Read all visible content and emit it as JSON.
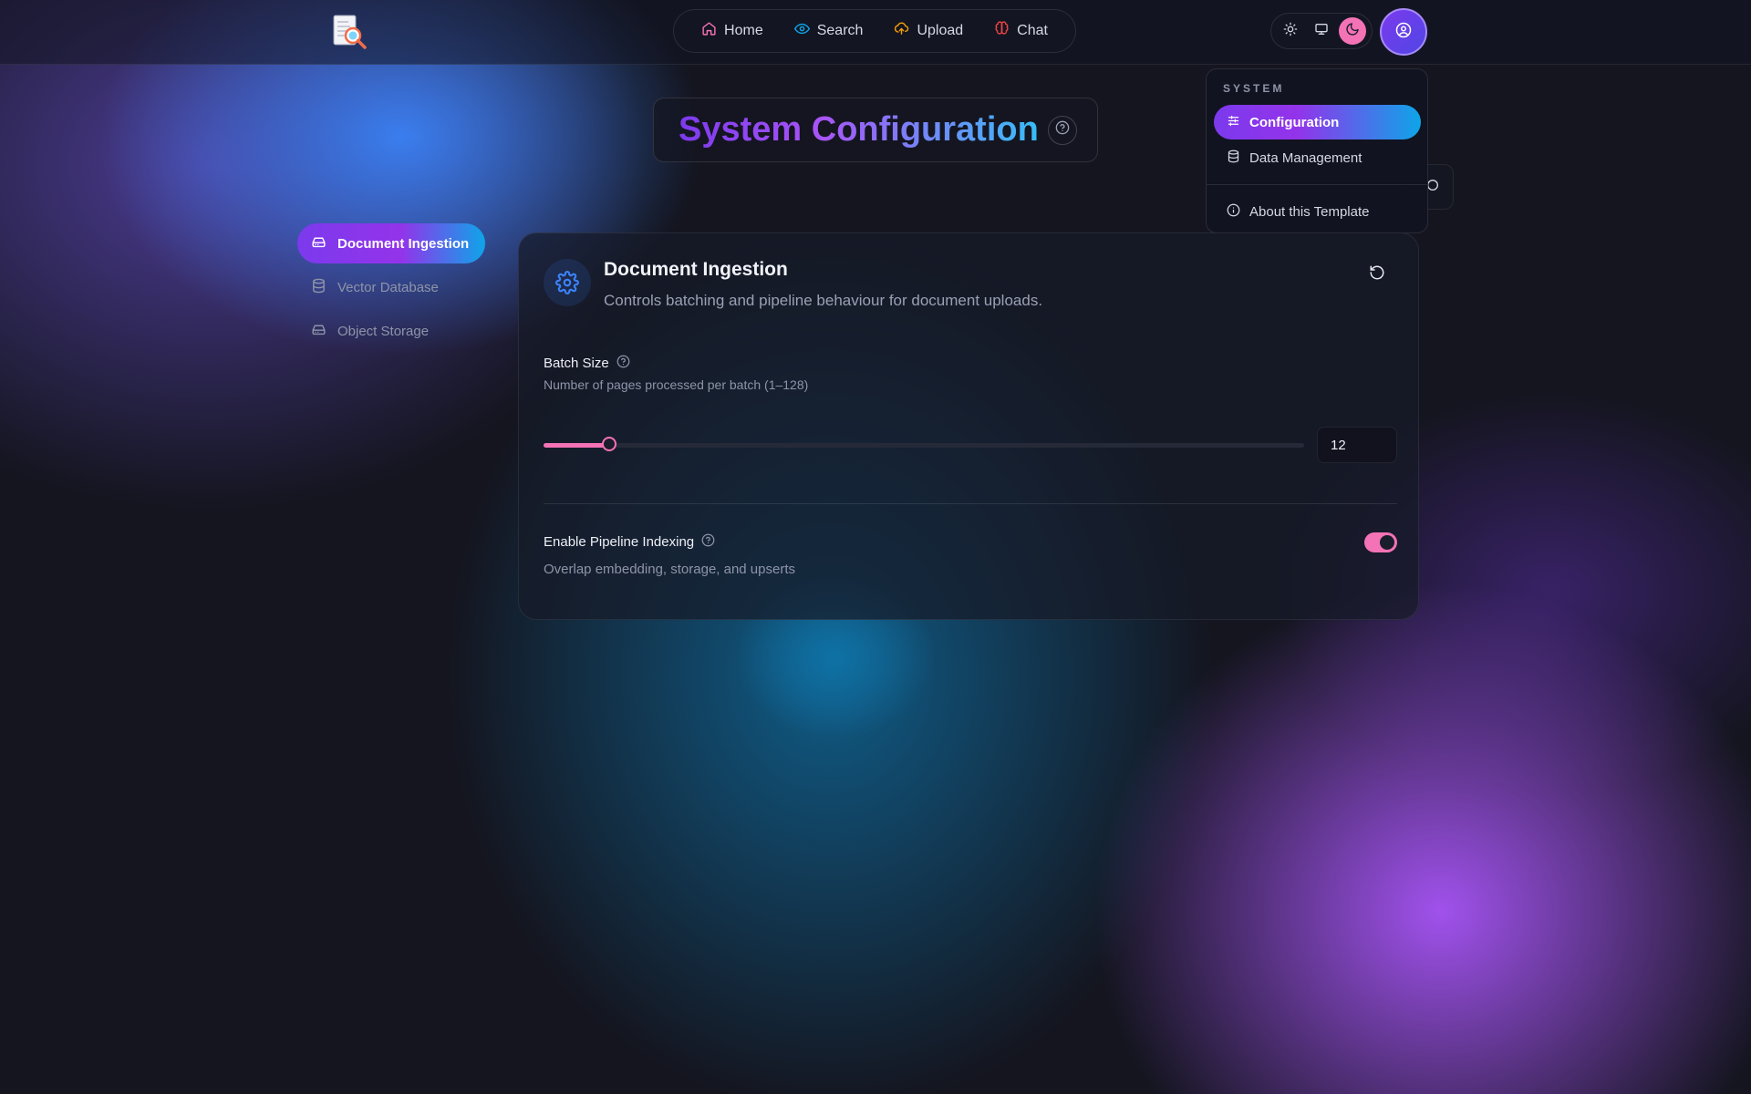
{
  "nav": {
    "items": [
      {
        "label": "Home",
        "icon": "home-icon",
        "color": "#f472b6"
      },
      {
        "label": "Search",
        "icon": "eye-icon",
        "color": "#0ea5e9"
      },
      {
        "label": "Upload",
        "icon": "cloud-upload-icon",
        "color": "#f59e0b"
      },
      {
        "label": "Chat",
        "icon": "brain-icon",
        "color": "#ef4444"
      }
    ]
  },
  "theme": {
    "options": [
      "light",
      "system",
      "dark"
    ],
    "selected": "dark",
    "accent": "#f472b6"
  },
  "page": {
    "title": "System Configuration"
  },
  "sidebar": {
    "items": [
      {
        "label": "Document Ingestion",
        "icon": "hard-drive-icon",
        "active": true
      },
      {
        "label": "Vector Database",
        "icon": "database-icon",
        "active": false
      },
      {
        "label": "Object Storage",
        "icon": "hard-drive-icon",
        "active": false
      }
    ]
  },
  "card": {
    "title": "Document Ingestion",
    "description": "Controls batching and pipeline behaviour for document uploads.",
    "icon": "gear-icon",
    "batch": {
      "label": "Batch Size",
      "hint": "Number of pages processed per batch (1–128)",
      "value": "12",
      "min": 1,
      "max": 128
    },
    "pipeline": {
      "label": "Enable Pipeline Indexing",
      "hint": "Overlap embedding, storage, and upserts",
      "enabled": true
    }
  },
  "menu": {
    "heading": "SYSTEM",
    "items": [
      {
        "label": "Configuration",
        "icon": "sliders-icon",
        "active": true
      },
      {
        "label": "Data Management",
        "icon": "database-icon",
        "active": false
      },
      {
        "label": "About this Template",
        "icon": "info-icon",
        "active": false
      }
    ]
  },
  "colors": {
    "background": "#14151f",
    "accent_pink": "#f472b6",
    "gradient_start": "#7c3aed",
    "gradient_end": "#0ea5e9"
  }
}
